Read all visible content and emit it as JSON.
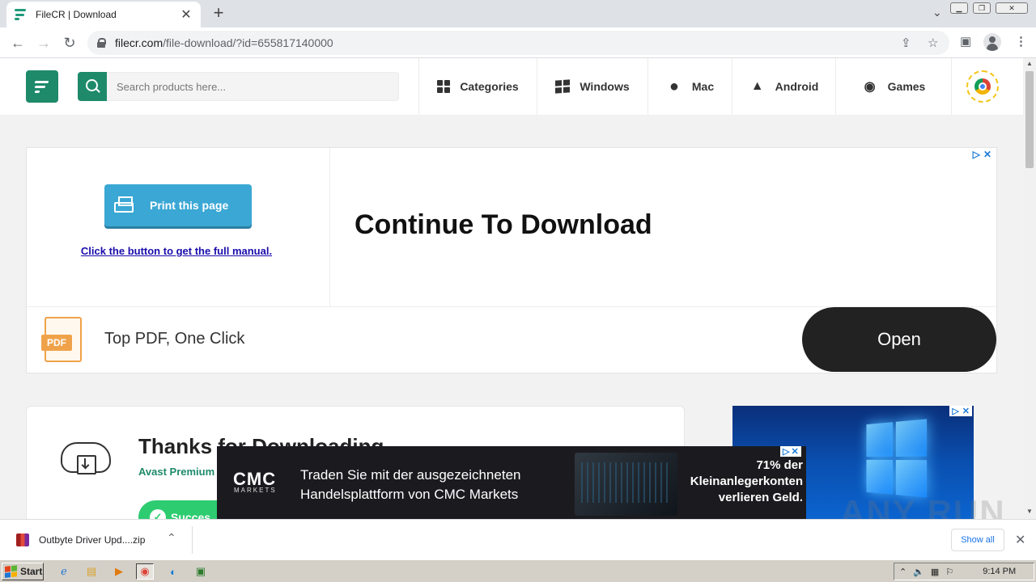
{
  "browser": {
    "tab_title": "FileCR | Download",
    "tab_close": "✕",
    "new_tab": "+",
    "url_host": "filecr.com",
    "url_path": "/file-download/?id=655817140000"
  },
  "site": {
    "search_placeholder": "Search products here...",
    "nav": [
      {
        "label": "Categories",
        "icon": "grid-icon"
      },
      {
        "label": "Windows",
        "icon": "windows-icon"
      },
      {
        "label": "Mac",
        "icon": "apple-icon"
      },
      {
        "label": "Android",
        "icon": "android-icon"
      },
      {
        "label": "Games",
        "icon": "gamepad-icon"
      }
    ]
  },
  "ad_top": {
    "print_button": "Print this page",
    "link": "Click the button to get the full manual.",
    "headline": "Continue To Download",
    "bottom_text": "Top PDF, One Click",
    "pdf_label": "PDF",
    "open_button": "Open",
    "adchoice_close": "✕"
  },
  "card": {
    "title": "Thanks for Downloading",
    "subtitle": "Avast Premium",
    "success_button": "Succes"
  },
  "cmc_ad": {
    "logo": "CMC",
    "logo_sub": "MARKETS",
    "line1": "Traden Sie mit der ausgezeichneten",
    "line2": "Handelsplattform von CMC Markets",
    "risk1": "71% der",
    "risk2": "Kleinanlegerkonten",
    "risk3": "verlieren Geld."
  },
  "downloads": {
    "file_name": "Outbyte Driver Upd....zip",
    "show_all": "Show all",
    "close": "✕"
  },
  "watermark": "ANY RUN",
  "taskbar": {
    "start": "Start",
    "clock": "9:14 PM"
  },
  "colors": {
    "brand": "#1e8a6a",
    "print_button": "#3ba7d4",
    "success": "#2ecc71"
  }
}
